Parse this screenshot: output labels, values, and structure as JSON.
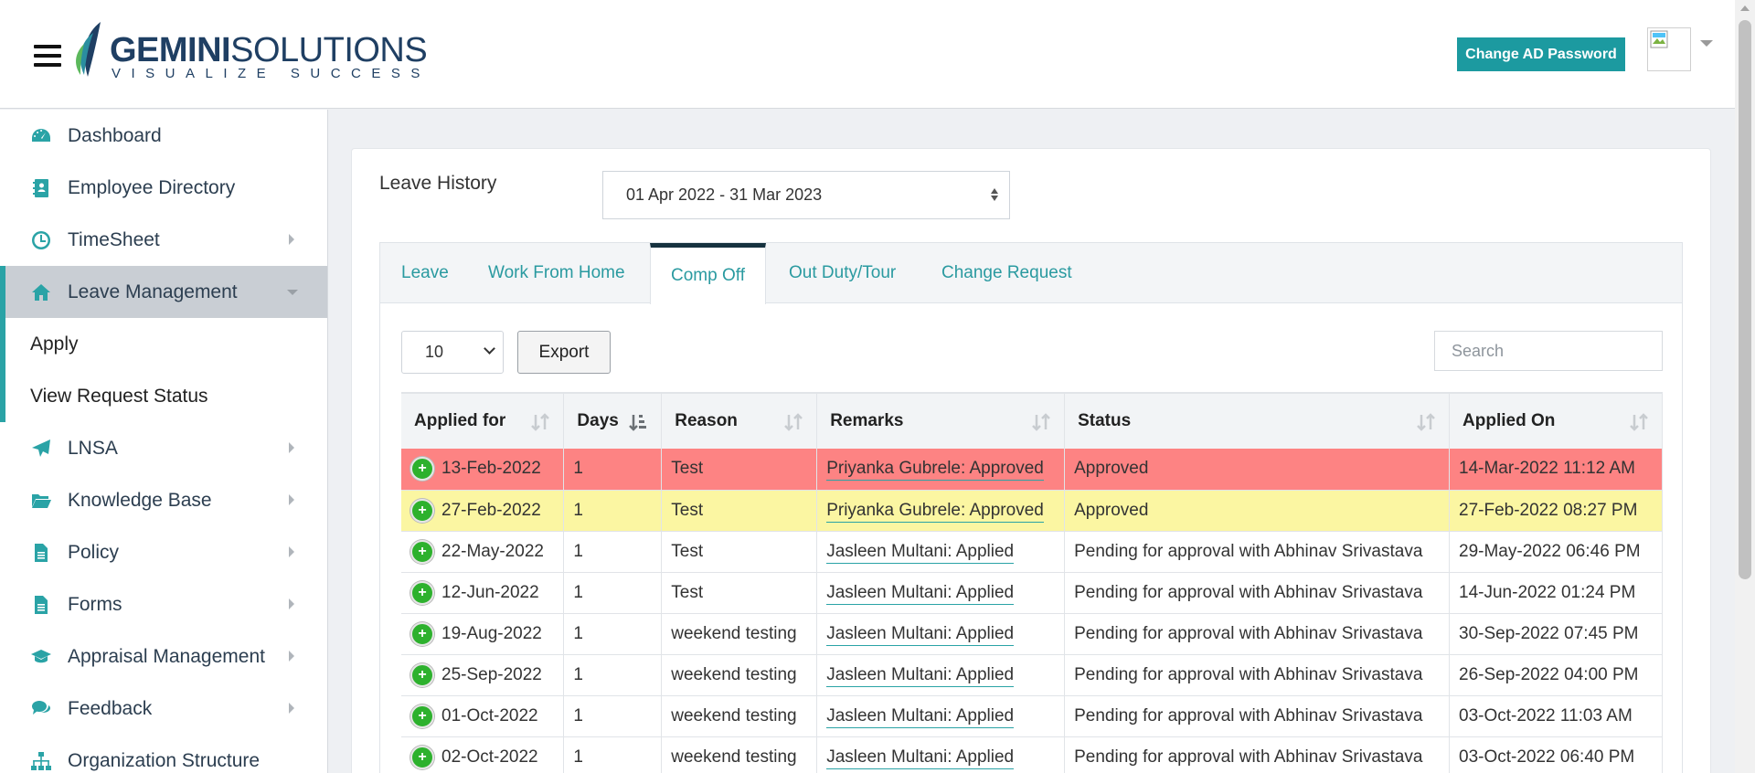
{
  "header": {
    "logo_word_bold": "GEMINI",
    "logo_word_light": "SOLUTIONS",
    "logo_tagline": "VISUALIZE SUCCESS",
    "change_password_label": "Change AD Password"
  },
  "sidebar": {
    "items": [
      {
        "label": "Dashboard",
        "icon": "dashboard-icon"
      },
      {
        "label": "Employee Directory",
        "icon": "address-book-icon"
      },
      {
        "label": "TimeSheet",
        "icon": "clock-icon"
      },
      {
        "label": "Leave Management",
        "icon": "home-icon"
      },
      {
        "label": "LNSA",
        "icon": "paper-plane-icon"
      },
      {
        "label": "Knowledge Base",
        "icon": "folder-open-icon"
      },
      {
        "label": "Policy",
        "icon": "document-icon"
      },
      {
        "label": "Forms",
        "icon": "form-document-icon"
      },
      {
        "label": "Appraisal Management",
        "icon": "graduation-cap-icon"
      },
      {
        "label": "Feedback",
        "icon": "comments-icon"
      },
      {
        "label": "Organization Structure",
        "icon": "sitemap-icon"
      }
    ],
    "sub_items": [
      "Apply",
      "View Request Status"
    ]
  },
  "main": {
    "title": "Leave History",
    "date_range": "01 Apr 2022 - 31 Mar 2023",
    "tabs": [
      "Leave",
      "Work From Home",
      "Comp Off",
      "Out Duty/Tour",
      "Change Request"
    ],
    "active_tab": "Comp Off",
    "page_length": "10",
    "export_label": "Export",
    "search_placeholder": "Search"
  },
  "table": {
    "columns": [
      "Applied for",
      "Days",
      "Reason",
      "Remarks",
      "Status",
      "Applied On"
    ],
    "rows": [
      {
        "applied_for": "13-Feb-2022",
        "days": "1",
        "reason": "Test",
        "remarks": "Priyanka Gubrele: Approved",
        "status": "Approved",
        "applied_on": "14-Mar-2022 11:12 AM",
        "highlight": "red"
      },
      {
        "applied_for": "27-Feb-2022",
        "days": "1",
        "reason": "Test",
        "remarks": "Priyanka Gubrele: Approved",
        "status": "Approved",
        "applied_on": "27-Feb-2022 08:27 PM",
        "highlight": "yellow"
      },
      {
        "applied_for": "22-May-2022",
        "days": "1",
        "reason": "Test",
        "remarks": "Jasleen Multani: Applied",
        "status": "Pending for approval with Abhinav Srivastava",
        "applied_on": "29-May-2022 06:46 PM",
        "highlight": "none"
      },
      {
        "applied_for": "12-Jun-2022",
        "days": "1",
        "reason": "Test",
        "remarks": "Jasleen Multani: Applied",
        "status": "Pending for approval with Abhinav Srivastava",
        "applied_on": "14-Jun-2022 01:24 PM",
        "highlight": "none"
      },
      {
        "applied_for": "19-Aug-2022",
        "days": "1",
        "reason": "weekend testing",
        "remarks": "Jasleen Multani: Applied",
        "status": "Pending for approval with Abhinav Srivastava",
        "applied_on": "30-Sep-2022 07:45 PM",
        "highlight": "none"
      },
      {
        "applied_for": "25-Sep-2022",
        "days": "1",
        "reason": "weekend testing",
        "remarks": "Jasleen Multani: Applied",
        "status": "Pending for approval with Abhinav Srivastava",
        "applied_on": "26-Sep-2022 04:00 PM",
        "highlight": "none"
      },
      {
        "applied_for": "01-Oct-2022",
        "days": "1",
        "reason": "weekend testing",
        "remarks": "Jasleen Multani: Applied",
        "status": "Pending for approval with Abhinav Srivastava",
        "applied_on": "03-Oct-2022 11:03 AM",
        "highlight": "none"
      },
      {
        "applied_for": "02-Oct-2022",
        "days": "1",
        "reason": "weekend testing",
        "remarks": "Jasleen Multani: Applied",
        "status": "Pending for approval with Abhinav Srivastava",
        "applied_on": "03-Oct-2022 06:40 PM",
        "highlight": "none"
      }
    ]
  },
  "colors": {
    "accent": "#2aa3a6",
    "brand_navy": "#1f3f63",
    "button_teal": "#1c9aa0",
    "row_red": "#fd8383",
    "row_yellow": "#fbf6a2",
    "plus_green": "#2db12d"
  }
}
